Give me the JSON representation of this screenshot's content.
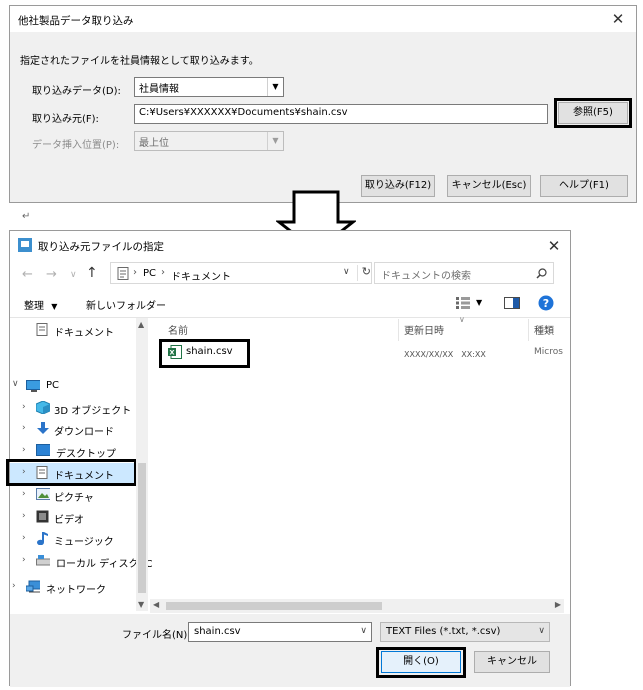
{
  "import_dialog": {
    "title": "他社製品データ取り込み",
    "description": "指定されたファイルを社員情報として取り込みます。",
    "data_label": "取り込みデータ(D):",
    "data_value": "社員情報",
    "source_label": "取り込み元(F):",
    "source_value": "C:¥Users¥XXXXXX¥Documents¥shain.csv",
    "browse_button": "参照(F5)",
    "insert_label": "データ挿入位置(P):",
    "insert_value": "最上位",
    "import_button": "取り込み(F12)",
    "cancel_button": "キャンセル(Esc)",
    "help_button": "ヘルプ(F1)"
  },
  "return_mark": "↵",
  "file_dialog": {
    "title": "取り込み元ファイルの指定",
    "address": {
      "pc": "PC",
      "folder": "ドキュメント"
    },
    "search_placeholder": "ドキュメントの検索",
    "toolbar": {
      "organize": "整理",
      "new_folder": "新しいフォルダー"
    },
    "nav": {
      "documents_top": "ドキュメント",
      "pc": "PC",
      "items": [
        "3D オブジェクト",
        "ダウンロード",
        "デスクトップ",
        "ドキュメント",
        "ピクチャ",
        "ビデオ",
        "ミュージック",
        "ローカル ディスク (C"
      ],
      "network": "ネットワーク"
    },
    "columns": {
      "name": "名前",
      "date": "更新日時",
      "type": "種類"
    },
    "file": {
      "name": "shain.csv",
      "date": "XXXX/XX/XX　XX:XX",
      "type": "Micros"
    },
    "filename_label": "ファイル名(N):",
    "filename_value": "shain.csv",
    "filter": "TEXT Files (*.txt, *.csv)",
    "open_button": "開く(O)",
    "cancel_button": "キャンセル"
  }
}
